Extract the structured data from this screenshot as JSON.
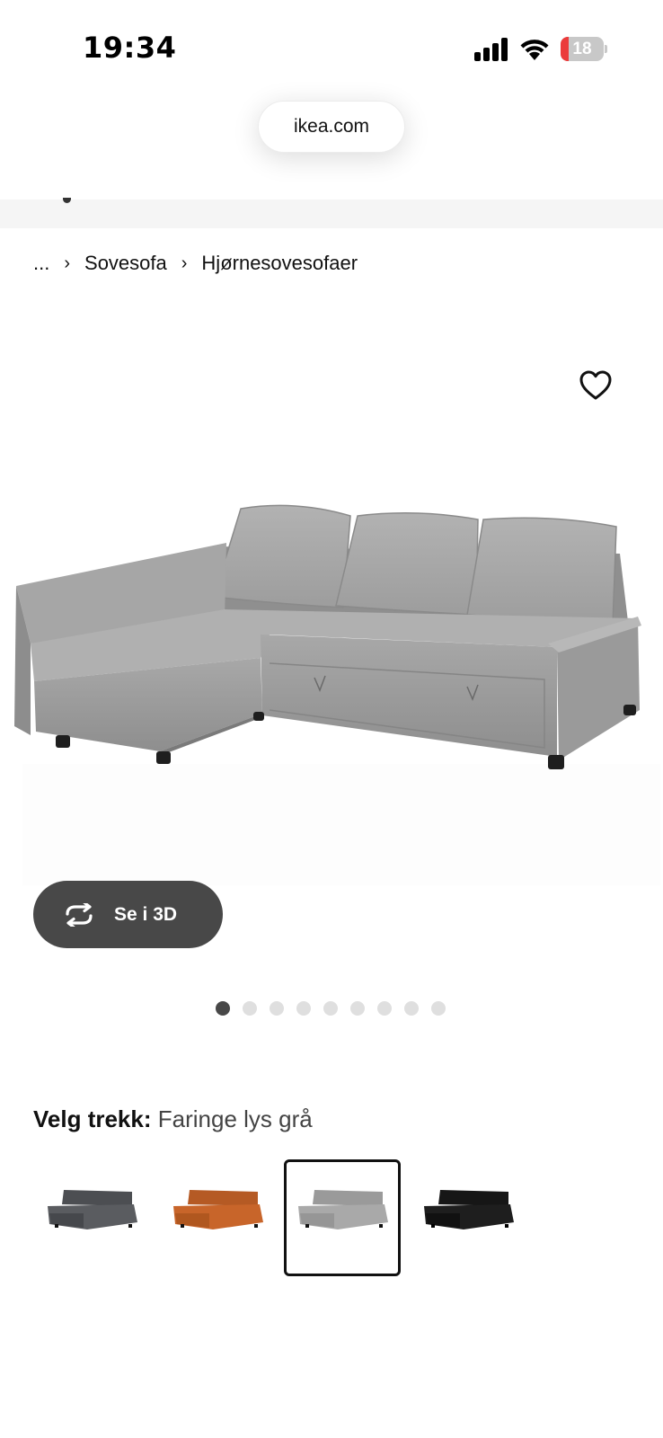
{
  "status_bar": {
    "time": "19:34",
    "battery_level": "18",
    "battery_color": "#eb3b3b"
  },
  "browser": {
    "url": "ikea.com"
  },
  "breadcrumb": {
    "ellipsis": "...",
    "items": [
      "Sovesofa",
      "Hjørnesovesofaer"
    ],
    "separator": "›"
  },
  "product": {
    "favorite_icon": "heart-outline-icon",
    "view_3d_label": "Se i 3D",
    "view_3d_icon": "rotate-arrows-icon",
    "image_count": 9,
    "active_image_index": 0
  },
  "cover": {
    "label": "Velg trekk:",
    "selected_value": "Faringe lys grå",
    "swatches": [
      {
        "name": "dark-grey",
        "color": "#5a5c60",
        "selected": false
      },
      {
        "name": "orange",
        "color": "#c8652a",
        "selected": false
      },
      {
        "name": "light-grey",
        "color": "#a9a9a9",
        "selected": true
      },
      {
        "name": "black",
        "color": "#1e1e1e",
        "selected": false
      }
    ]
  },
  "colors": {
    "button_dark": "#484848",
    "dot_inactive": "#dfdfdf",
    "sofa_fabric": "#9c9c9c"
  }
}
